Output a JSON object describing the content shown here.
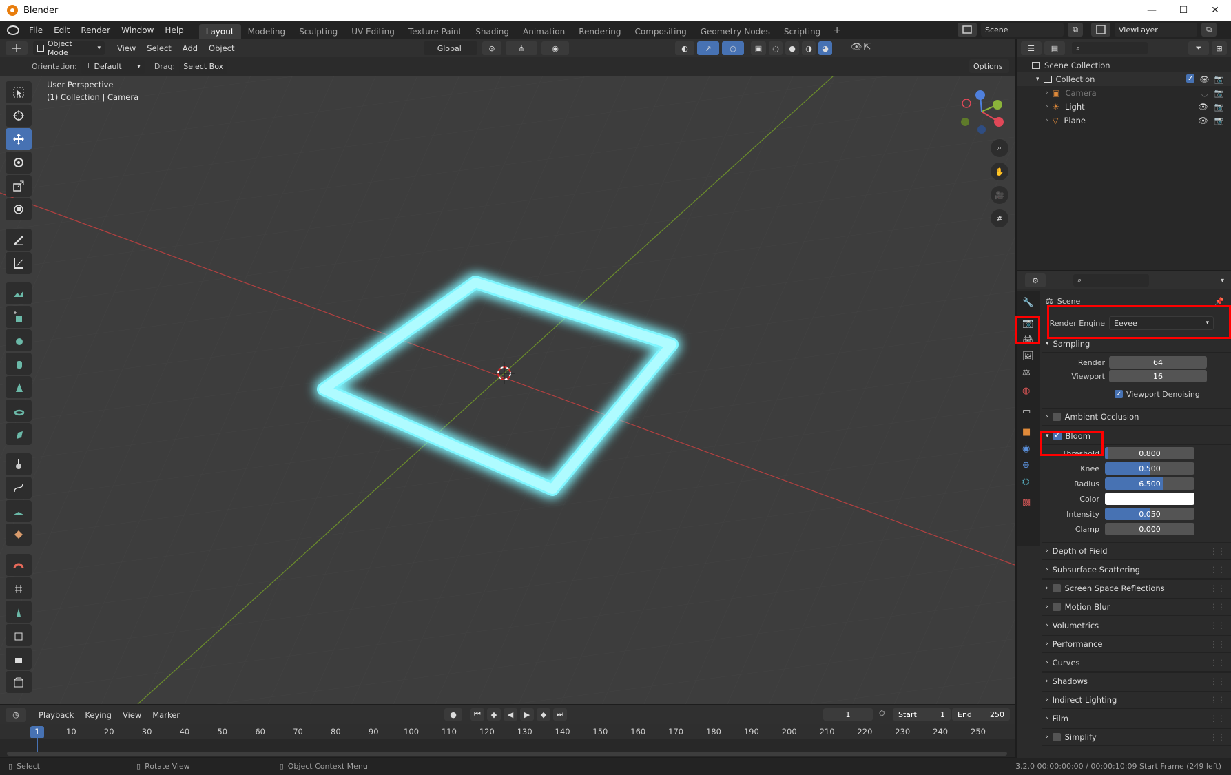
{
  "window": {
    "title": "Blender",
    "minimize": "—",
    "maximize": "☐",
    "close": "✕"
  },
  "menu": {
    "items": [
      "File",
      "Edit",
      "Render",
      "Window",
      "Help"
    ]
  },
  "workspaces": [
    "Layout",
    "Modeling",
    "Sculpting",
    "UV Editing",
    "Texture Paint",
    "Shading",
    "Animation",
    "Rendering",
    "Compositing",
    "Geometry Nodes",
    "Scripting"
  ],
  "workspace_add": "+",
  "scene": {
    "name": "Scene",
    "view_layer": "ViewLayer"
  },
  "viewport_header": {
    "mode": "Object Mode",
    "menus": [
      "View",
      "Select",
      "Add",
      "Object"
    ],
    "transform_orientation": "Global"
  },
  "tool_header": {
    "orientation_label": "Orientation:",
    "orientation_value": "Default",
    "drag_label": "Drag:",
    "drag_value": "Select Box",
    "options": "Options"
  },
  "viewport": {
    "perspective": "User Perspective",
    "context": "(1) Collection | Camera",
    "gizmo": {
      "x": "X",
      "y": "Y",
      "z": "Z"
    }
  },
  "outliner": {
    "root": "Scene Collection",
    "collection": "Collection",
    "objects": [
      {
        "name": "Camera",
        "icon": "camera-object-icon",
        "visible": false
      },
      {
        "name": "Light",
        "icon": "light-object-icon",
        "visible": true
      },
      {
        "name": "Plane",
        "icon": "mesh-object-icon",
        "visible": true
      }
    ]
  },
  "properties": {
    "context": "Scene",
    "render_engine_label": "Render Engine",
    "render_engine_value": "Eevee",
    "sampling": {
      "title": "Sampling",
      "render_label": "Render",
      "render_value": "64",
      "viewport_label": "Viewport",
      "viewport_value": "16",
      "viewport_denoising": "Viewport Denoising",
      "viewport_denoising_checked": true
    },
    "ambient_occlusion": "Ambient Occlusion",
    "bloom": {
      "title": "Bloom",
      "enabled": true,
      "threshold_label": "Threshold",
      "threshold": "0.800",
      "threshold_fraction": 0.04,
      "knee_label": "Knee",
      "knee": "0.500",
      "knee_fraction": 0.5,
      "radius_label": "Radius",
      "radius": "6.500",
      "radius_fraction": 0.65,
      "color_label": "Color",
      "color": "#ffffff",
      "intensity_label": "Intensity",
      "intensity": "0.050",
      "intensity_fraction": 0.5,
      "clamp_label": "Clamp",
      "clamp": "0.000"
    },
    "panels": [
      {
        "name": "Depth of Field",
        "has_checkbox": false
      },
      {
        "name": "Subsurface Scattering",
        "has_checkbox": false
      },
      {
        "name": "Screen Space Reflections",
        "has_checkbox": true
      },
      {
        "name": "Motion Blur",
        "has_checkbox": true
      },
      {
        "name": "Volumetrics",
        "has_checkbox": false
      },
      {
        "name": "Performance",
        "has_checkbox": false
      },
      {
        "name": "Curves",
        "has_checkbox": false
      },
      {
        "name": "Shadows",
        "has_checkbox": false
      },
      {
        "name": "Indirect Lighting",
        "has_checkbox": false
      },
      {
        "name": "Film",
        "has_checkbox": false
      },
      {
        "name": "Simplify",
        "has_checkbox": true
      }
    ]
  },
  "timeline": {
    "menus": [
      "Playback",
      "Keying",
      "View",
      "Marker"
    ],
    "current_frame": "1",
    "start_label": "Start",
    "start": "1",
    "end_label": "End",
    "end": "250",
    "ticks": [
      "1",
      "10",
      "20",
      "30",
      "40",
      "50",
      "60",
      "70",
      "80",
      "90",
      "100",
      "110",
      "120",
      "130",
      "140",
      "150",
      "160",
      "170",
      "180",
      "190",
      "200",
      "210",
      "220",
      "230",
      "240",
      "250"
    ]
  },
  "statusbar": {
    "select": "Select",
    "rotate": "Rotate View",
    "context_menu": "Object Context Menu",
    "info": "3.2.0  00:00:00:00 / 00:00:10:09  Start Frame (249 left)"
  },
  "colors": {
    "accent": "#4772b3",
    "glow": "#7ff6ff",
    "highlight": "#ff0000"
  }
}
